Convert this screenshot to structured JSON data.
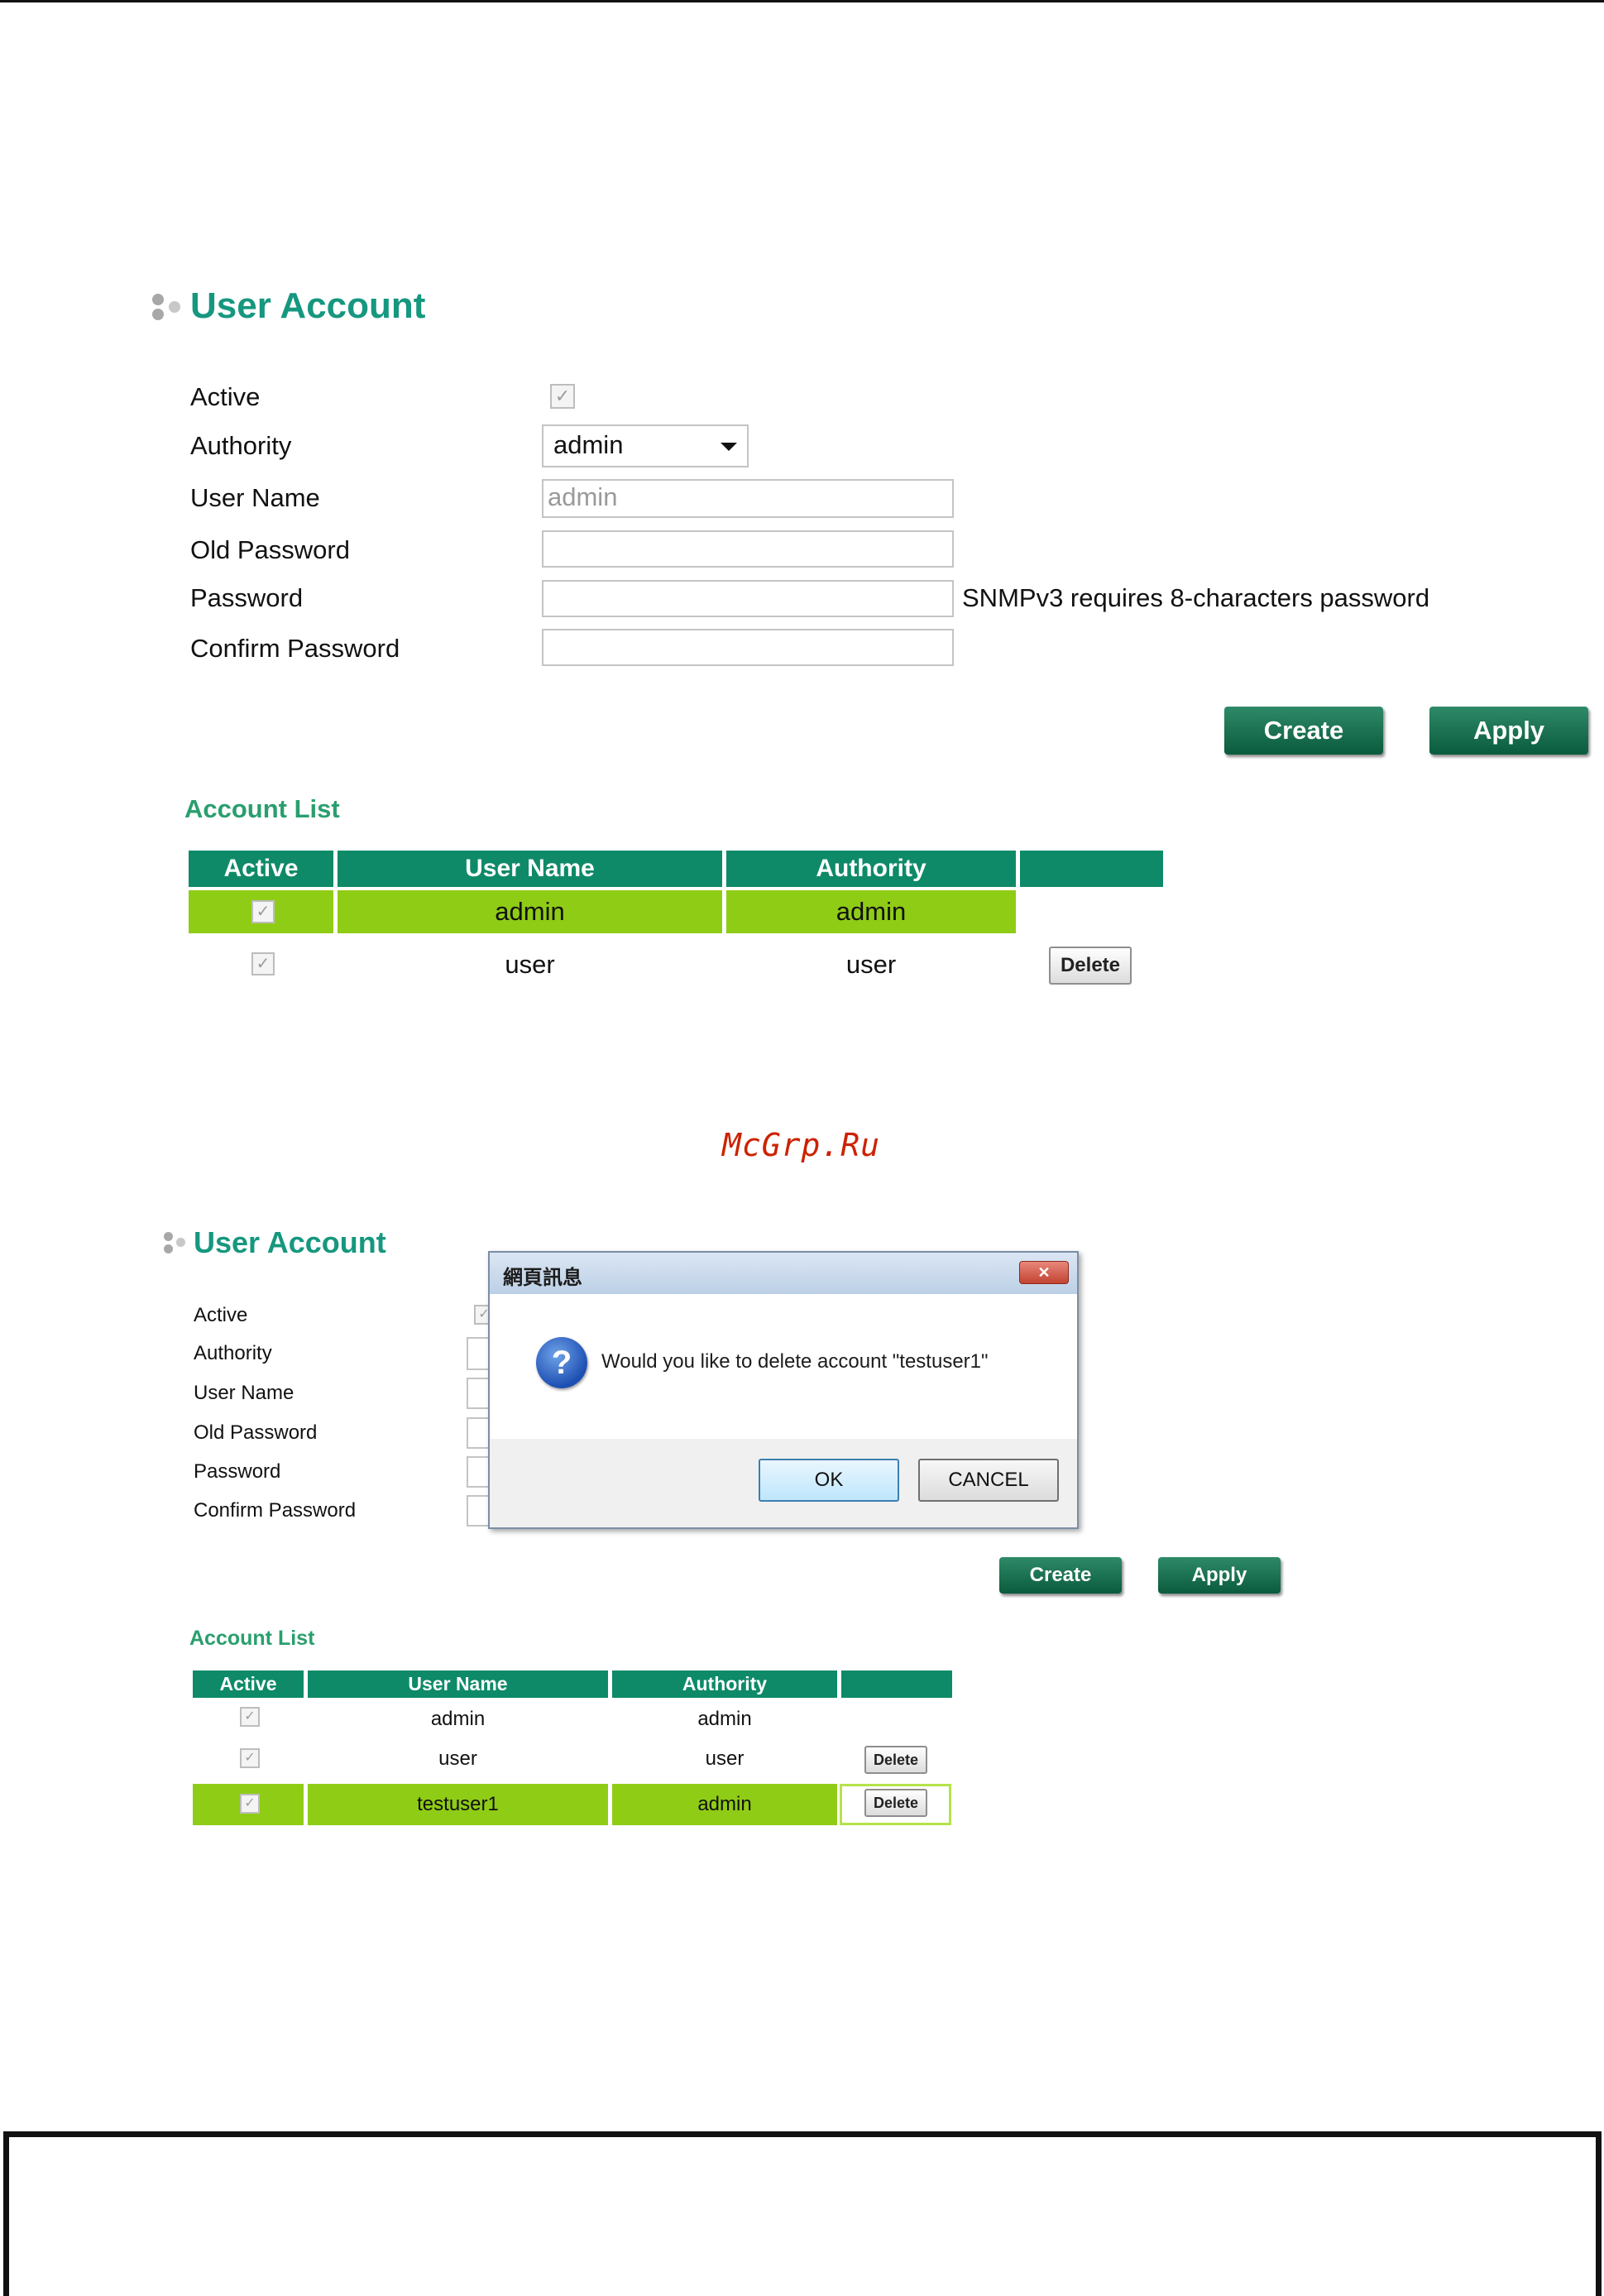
{
  "screen1": {
    "title": "User Account",
    "form": {
      "active_label": "Active",
      "authority_label": "Authority",
      "authority_value": "admin",
      "user_name_label": "User Name",
      "user_name_value": "admin",
      "old_password_label": "Old Password",
      "password_label": "Password",
      "password_hint": "SNMPv3 requires 8-characters password",
      "confirm_password_label": "Confirm Password"
    },
    "buttons": {
      "create": "Create",
      "apply": "Apply"
    },
    "account_list_title": "Account List",
    "table": {
      "headers": [
        "Active",
        "User Name",
        "Authority"
      ],
      "rows": [
        {
          "checked": "✓",
          "user": "admin",
          "authority": "admin"
        },
        {
          "checked": "✓",
          "user": "user",
          "authority": "user",
          "delete": "Delete"
        }
      ]
    }
  },
  "watermark": "McGrp.Ru",
  "screen2": {
    "title": "User Account",
    "form": {
      "active_label": "Active",
      "authority_label": "Authority",
      "user_name_label": "User Name",
      "old_password_label": "Old Password",
      "password_label": "Password",
      "confirm_password_label": "Confirm Password"
    },
    "buttons": {
      "create": "Create",
      "apply": "Apply"
    },
    "account_list_title": "Account List",
    "table": {
      "headers": [
        "Active",
        "User Name",
        "Authority"
      ],
      "rows": [
        {
          "checked": "✓",
          "user": "admin",
          "authority": "admin"
        },
        {
          "checked": "✓",
          "user": "user",
          "authority": "user",
          "delete": "Delete"
        },
        {
          "checked": "✓",
          "user": "testuser1",
          "authority": "admin",
          "delete": "Delete"
        }
      ]
    },
    "dialog": {
      "title": "網頁訊息",
      "close_glyph": "✕",
      "icon_glyph": "?",
      "message": "Would you like to delete account \"testuser1\"",
      "ok": "OK",
      "cancel": "CANCEL"
    }
  },
  "colors": {
    "heading_teal": "#16977f",
    "table_header": "#0e8a68",
    "row_highlight": "#8fcc16",
    "button_green": "#0a5b3d",
    "watermark_red": "#cc2200"
  }
}
